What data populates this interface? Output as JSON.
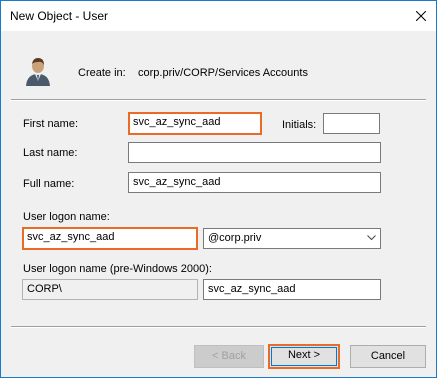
{
  "window": {
    "title": "New Object - User"
  },
  "header": {
    "create_in_label": "Create in:",
    "create_in_path": "corp.priv/CORP/Services Accounts"
  },
  "form": {
    "first_name_label": "First name:",
    "first_name_value": "svc_az_sync_aad",
    "initials_label": "Initials:",
    "initials_value": "",
    "last_name_label": "Last name:",
    "last_name_value": "",
    "full_name_label": "Full name:",
    "full_name_value": "svc_az_sync_aad",
    "logon_name_label": "User logon name:",
    "logon_name_value": "svc_az_sync_aad",
    "domain_selected": "@corp.priv",
    "pre2000_label": "User logon name (pre-Windows 2000):",
    "pre2000_domain": "CORP\\",
    "pre2000_value": "svc_az_sync_aad"
  },
  "buttons": {
    "back": "< Back",
    "next": "Next >",
    "cancel": "Cancel"
  },
  "colors": {
    "highlight": "#ea6b25",
    "window_border": "#1979ca"
  },
  "icons": {
    "close": "close-icon",
    "user": "user-icon",
    "dropdown": "chevron-down-icon"
  }
}
